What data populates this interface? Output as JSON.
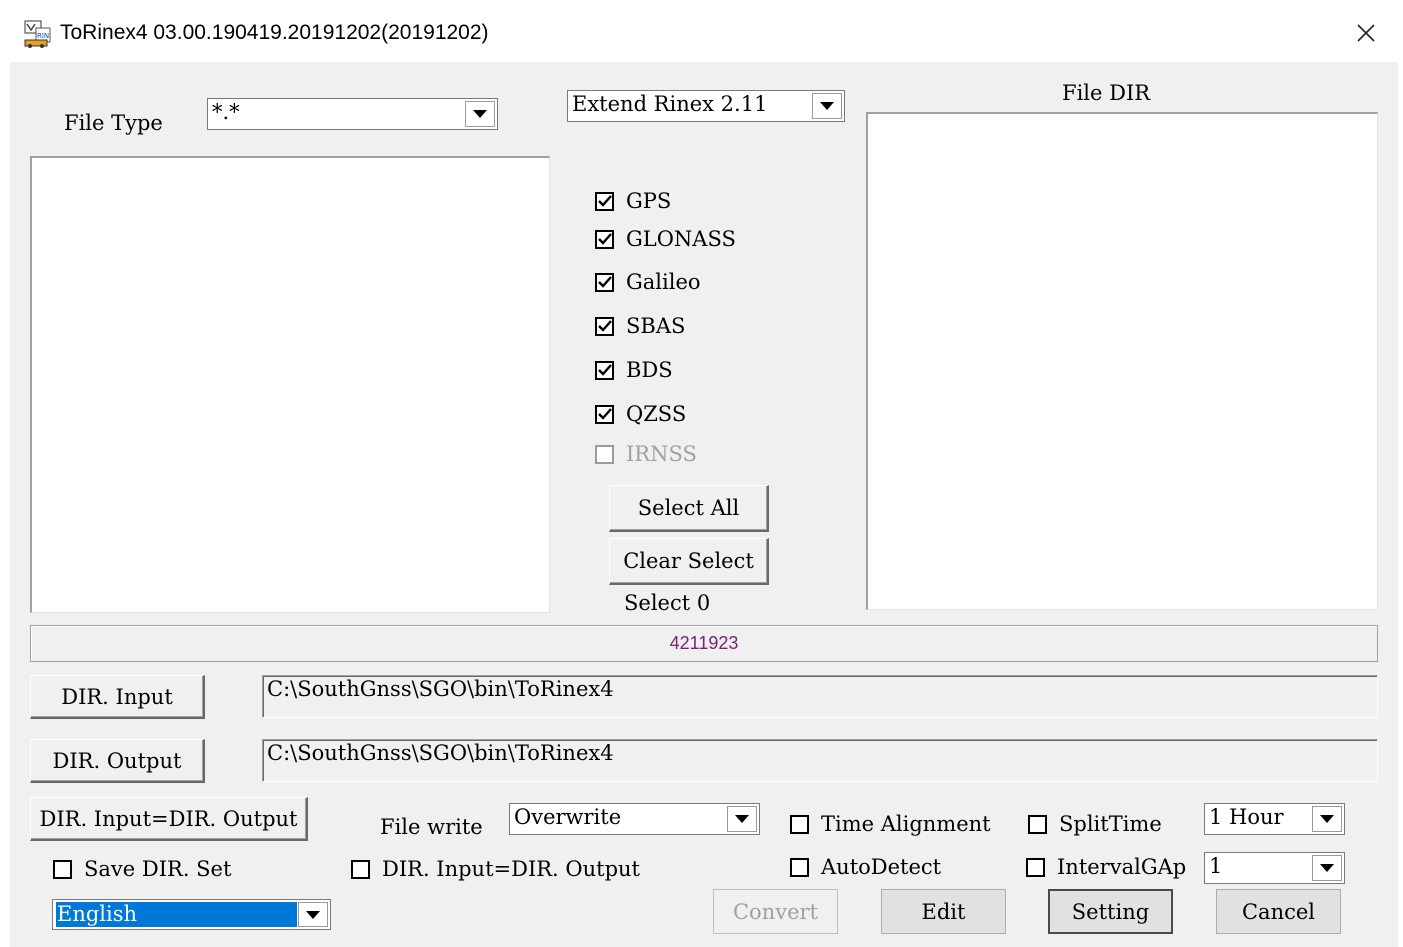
{
  "window": {
    "title": "ToRinex4 03.00.190419.20191202(20191202)",
    "icon": "app-icon"
  },
  "file_type": {
    "label": "File Type",
    "value": "*.*"
  },
  "rinex_version": {
    "value": "Extend Rinex 2.11"
  },
  "file_dir": {
    "label": "File DIR"
  },
  "systems": [
    {
      "label": "GPS",
      "checked": true,
      "enabled": true
    },
    {
      "label": "GLONASS",
      "checked": true,
      "enabled": true
    },
    {
      "label": "Galileo",
      "checked": true,
      "enabled": true
    },
    {
      "label": "SBAS",
      "checked": true,
      "enabled": true
    },
    {
      "label": "BDS",
      "checked": true,
      "enabled": true
    },
    {
      "label": "QZSS",
      "checked": true,
      "enabled": true
    },
    {
      "label": "IRNSS",
      "checked": false,
      "enabled": false
    }
  ],
  "buttons": {
    "select_all": "Select All",
    "clear_select": "Clear Select",
    "dir_input": "DIR. Input",
    "dir_output": "DIR. Output",
    "dir_input_eq_output": "DIR. Input=DIR. Output",
    "convert": "Convert",
    "edit": "Edit",
    "setting": "Setting",
    "cancel": "Cancel"
  },
  "select_count": "Select 0",
  "status": {
    "value": "4211923",
    "color": "#7a1f7a"
  },
  "paths": {
    "input": "C:\\SouthGnss\\SGO\\bin\\ToRinex4",
    "output": "C:\\SouthGnss\\SGO\\bin\\ToRinex4"
  },
  "file_write": {
    "label": "File write",
    "value": "Overwrite"
  },
  "options": {
    "time_alignment": {
      "label": "Time Alignment",
      "checked": false
    },
    "split_time": {
      "label": "SplitTime",
      "checked": false
    },
    "split_time_value": "1 Hour",
    "save_dir_set": {
      "label": "Save DIR. Set",
      "checked": false
    },
    "dir_input_eq_output": {
      "label": "DIR. Input=DIR. Output",
      "checked": false
    },
    "auto_detect": {
      "label": "AutoDetect",
      "checked": false
    },
    "interval_gap": {
      "label": "IntervalGAp",
      "checked": false
    },
    "interval_gap_value": "1"
  },
  "language": {
    "value": "English",
    "highlight": "#0078d7"
  }
}
